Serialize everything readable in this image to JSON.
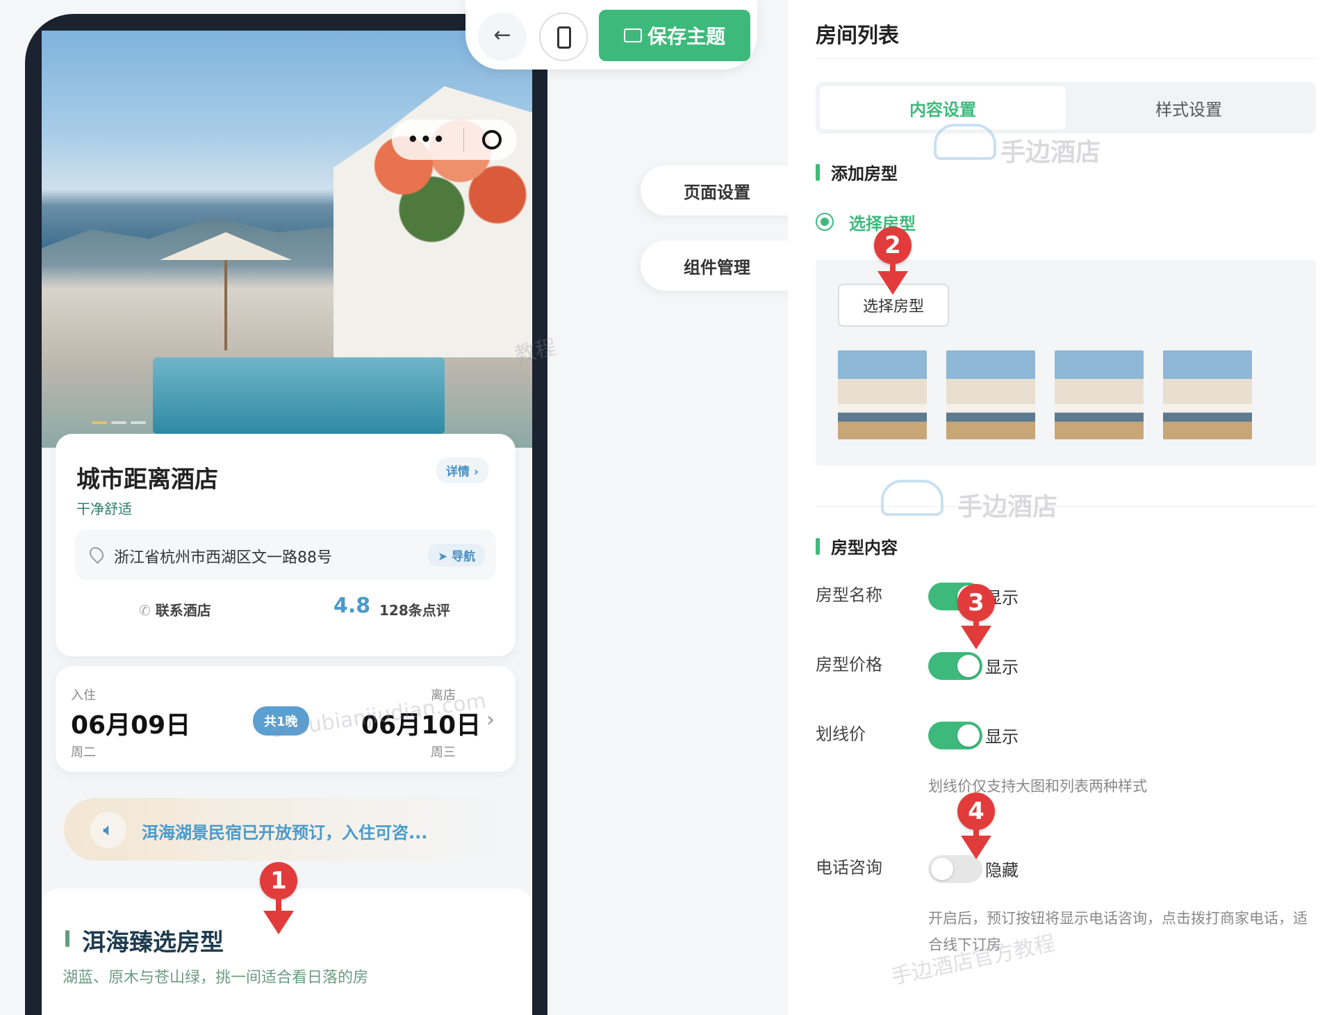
{
  "toolbar": {
    "back_icon": "arrow-left-icon",
    "device_icon": "phone-icon",
    "save_label": "保存主题",
    "save_color": "#3dba7b"
  },
  "side_menu": {
    "items": [
      {
        "label": "页面设置"
      },
      {
        "label": "组件管理"
      }
    ]
  },
  "preview": {
    "capsule": {
      "more": "•••"
    },
    "hotel": {
      "name": "城市距离酒店",
      "tagline": "干净舒适",
      "detail_label": "详情 ›",
      "address": "浙江省杭州市西湖区文一路88号",
      "nav_label": "导航",
      "contact_label": "联系酒店",
      "rating": "4.8",
      "reviews": "128条点评"
    },
    "dates": {
      "checkin_label": "入住",
      "checkin_date": "06月09日",
      "checkin_weekday": "周二",
      "nights": "共1晚",
      "checkout_label": "离店",
      "checkout_date": "06月10日",
      "checkout_weekday": "周三"
    },
    "notice": "洱海湖景民宿已开放预订，入住可咨...",
    "rooms": {
      "title": "洱海臻选房型",
      "subtitle": "湖蓝、原木与苍山绿，挑一间适合看日落的房"
    }
  },
  "panel": {
    "title": "房间列表",
    "tabs": [
      {
        "label": "内容设置",
        "active": true
      },
      {
        "label": "样式设置",
        "active": false
      }
    ],
    "add_section": {
      "title": "添加房型",
      "radio_label": "选择房型",
      "select_button": "选择房型",
      "thumbnail_count": 4
    },
    "content_section": {
      "title": "房型内容",
      "fields": [
        {
          "label": "房型名称",
          "state": "显示",
          "on": true
        },
        {
          "label": "房型价格",
          "state": "显示",
          "on": true
        },
        {
          "label": "划线价",
          "state": "显示",
          "on": true,
          "hint": "划线价仅支持大图和列表两种样式"
        },
        {
          "label": "电话咨询",
          "state": "隐藏",
          "on": false,
          "hint": "开启后，预订按钮将显示电话咨询，点击拨打商家电话，适合线下订房"
        }
      ]
    }
  },
  "annotations": [
    "1",
    "2",
    "3",
    "4"
  ],
  "watermarks": {
    "brand": "手边酒店",
    "tutorial": "手边酒店官方教程",
    "domain": "shoubianjiudian.com",
    "fragment": "教程"
  }
}
